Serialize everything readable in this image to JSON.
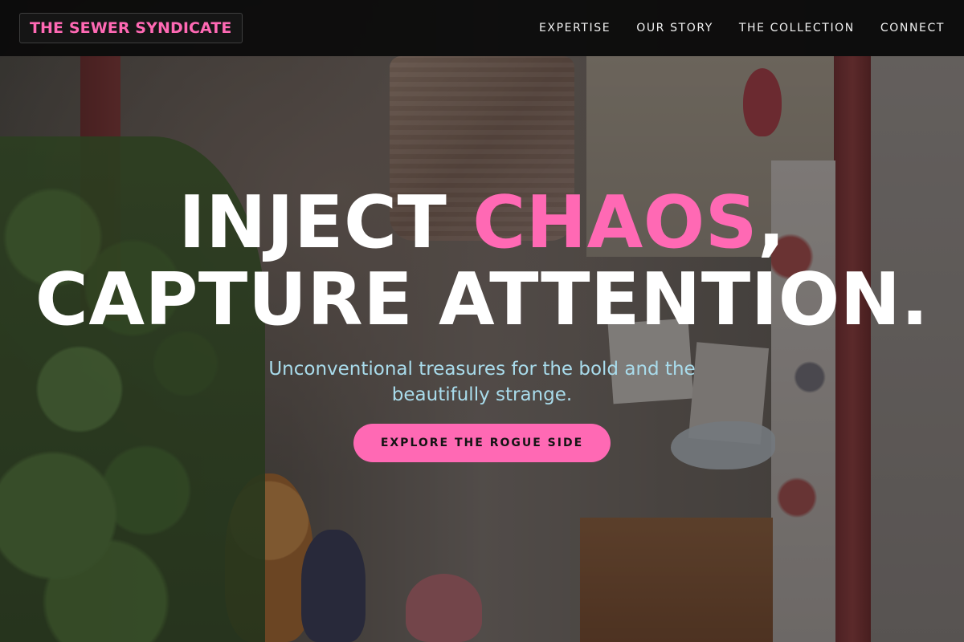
{
  "header": {
    "brand": "THE SEWER SYNDICATE",
    "nav": [
      {
        "label": "EXPERTISE"
      },
      {
        "label": "OUR STORY"
      },
      {
        "label": "THE COLLECTION"
      },
      {
        "label": "CONNECT"
      }
    ]
  },
  "hero": {
    "headline_part1": "INJECT ",
    "headline_accent": "CHAOS",
    "headline_part2": ",",
    "headline_line2": "CAPTURE ATTENTION.",
    "subtitle": "Unconventional treasures for the bold and the beautifully strange.",
    "cta_label": "EXPLORE THE ROGUE SIDE"
  },
  "colors": {
    "accent": "#ff69b4",
    "header_bg": "#0a0a0a",
    "subtitle": "#a9dcec",
    "headline": "#ffffff"
  }
}
